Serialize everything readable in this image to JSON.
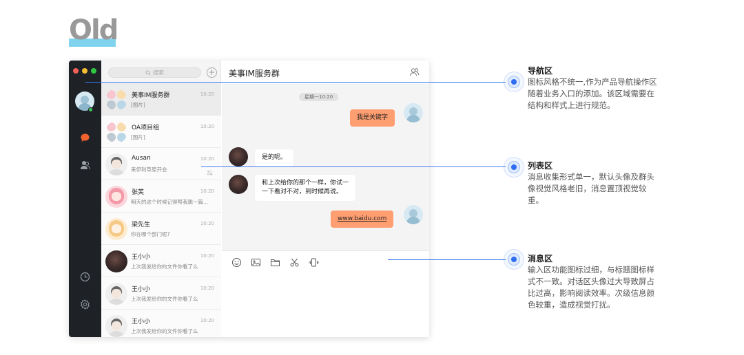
{
  "heading": "Old",
  "window": {
    "search_placeholder": "搜索",
    "add_label": "+",
    "chat_title": "美事IM服务群",
    "date_chip": "星期一10:20",
    "conversations": [
      {
        "name": "美事IM服务群",
        "preview": "[图片]",
        "time": "10:20",
        "avatar": "group"
      },
      {
        "name": "OA项目组",
        "preview": "[图片]",
        "time": "10:20",
        "avatar": "group"
      },
      {
        "name": "Ausan",
        "preview": "来伊利草原开会",
        "time": "10:20",
        "avatar": "default",
        "muted": true
      },
      {
        "name": "张芙",
        "preview": "明天的这个时候记得帮我跳一篇...",
        "time": "10:20",
        "avatar": "pink"
      },
      {
        "name": "梁先生",
        "preview": "你在哪个部门呢?",
        "time": "10:20",
        "avatar": "yellow"
      },
      {
        "name": "王小小",
        "preview": "上次我发给你的文件你看了么",
        "time": "10:20",
        "avatar": "photo"
      },
      {
        "name": "王小小",
        "preview": "上次我发给你的文件你看了么",
        "time": "10:20",
        "avatar": "default"
      },
      {
        "name": "王小小",
        "preview": "上次我发给你的文件你看了么",
        "time": "10:20",
        "avatar": "default"
      }
    ],
    "messages": {
      "m1": "我是关键字",
      "m2": "是的呢。",
      "m3_line1": "和上次给你的那个一样，你试一",
      "m3_line2": "一下看对不对，到时候再说。",
      "m4": "www.baidu.com"
    },
    "toolbar_icons": [
      "emoji-icon",
      "image-icon",
      "folder-icon",
      "scissors-icon",
      "shake-icon"
    ],
    "nav_icons": [
      "chat-icon",
      "contacts-icon",
      "clock-icon",
      "gear-icon"
    ]
  },
  "annotations": [
    {
      "title": "导航区",
      "lines": [
        "图标风格不统一,作为产品导航操作区",
        "随着业务入口的添加。该区域需要在",
        "结构和样式上进行规范。"
      ]
    },
    {
      "title": "列表区",
      "lines": [
        "消息收集形式单一，默认头像及群头",
        "像视觉风格老旧，消息置顶视觉较",
        "重。"
      ]
    },
    {
      "title": "消息区",
      "lines": [
        "输入区功能图标过细，与标题图标样",
        "式不一致。对话区头像过大导致屏占",
        "比过高，影响阅读效率。次级信息颜",
        "色较重，造成视觉打扰。"
      ]
    }
  ],
  "colors": {
    "accent": "#2f6ef0",
    "bubble_self": "#ff9e70",
    "nav_bg": "#1e2227",
    "heading_underline": "#7fd3ec"
  }
}
